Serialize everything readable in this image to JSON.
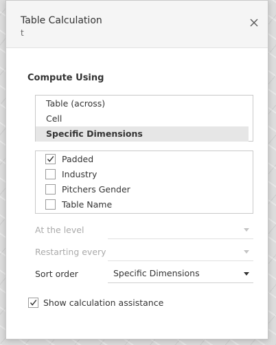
{
  "dialog": {
    "title": "Table Calculation",
    "subtitle": "t",
    "close_icon": "close-icon"
  },
  "compute_using": {
    "label": "Compute Using",
    "options": [
      "Table (across)",
      "Cell",
      "Specific Dimensions"
    ],
    "selected": "Specific Dimensions"
  },
  "dimensions": [
    {
      "label": "Padded",
      "checked": true
    },
    {
      "label": "Industry",
      "checked": false
    },
    {
      "label": "Pitchers Gender",
      "checked": false
    },
    {
      "label": "Table Name",
      "checked": false
    }
  ],
  "at_the_level": {
    "label": "At the level",
    "value": "",
    "enabled": false
  },
  "restarting_every": {
    "label": "Restarting every",
    "value": "",
    "enabled": false
  },
  "sort_order": {
    "label": "Sort order",
    "value": "Specific Dimensions",
    "enabled": true
  },
  "show_assistance": {
    "label": "Show calculation assistance",
    "checked": true
  }
}
